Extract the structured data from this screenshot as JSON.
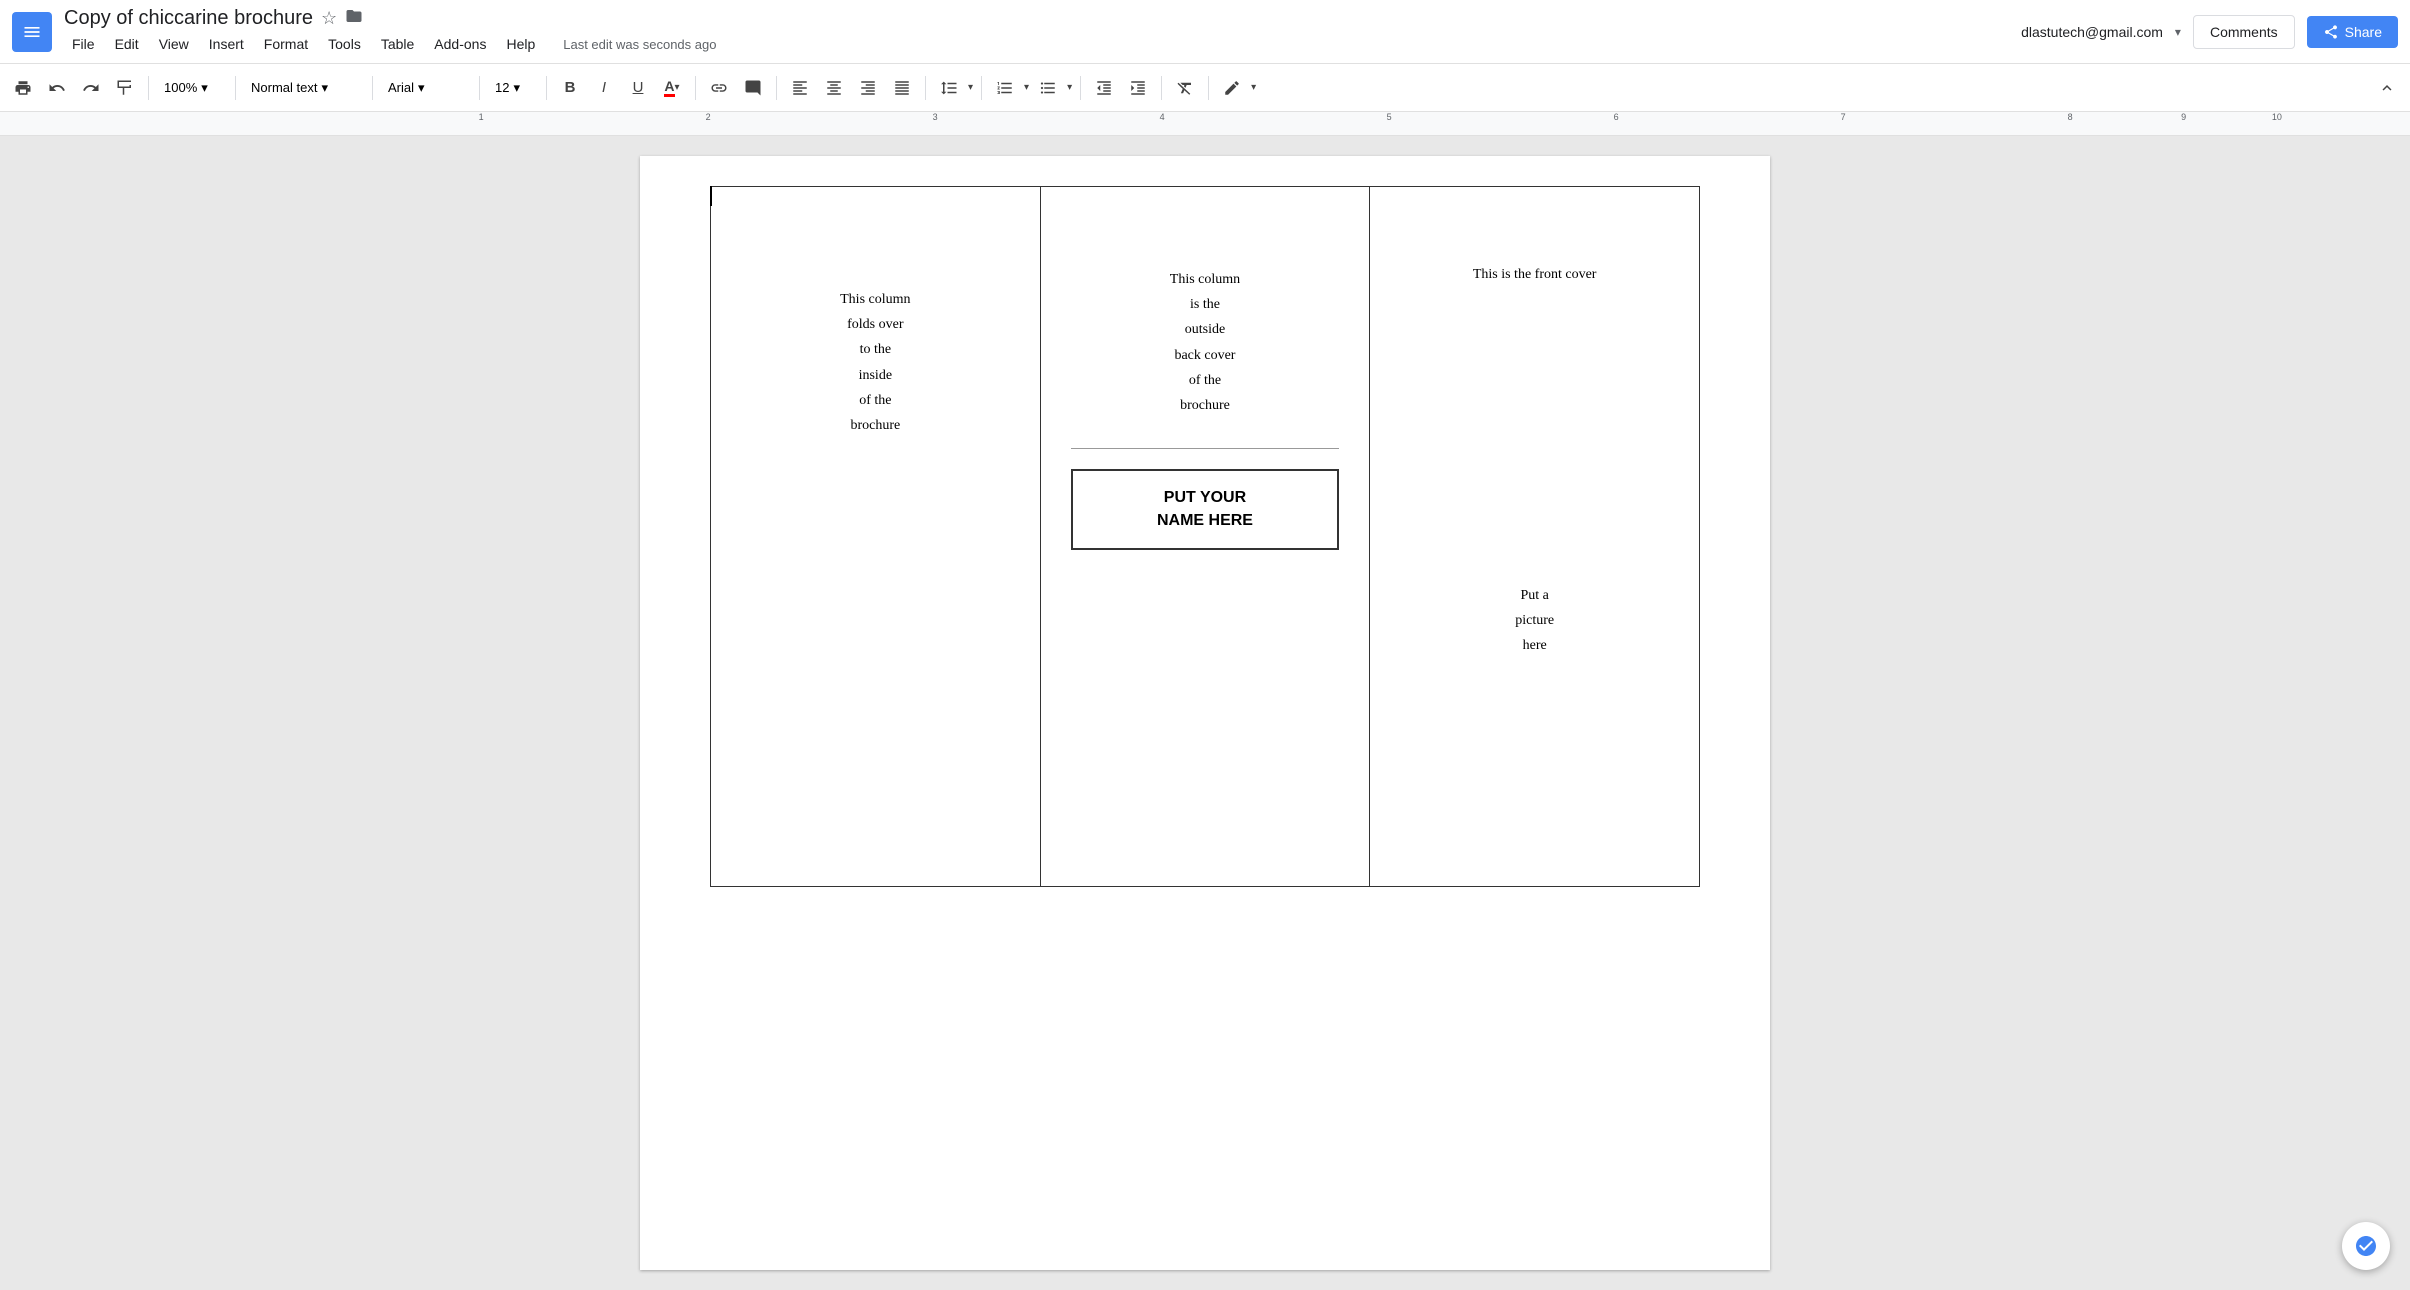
{
  "app": {
    "icon_label": "≡",
    "title": "Copy of chiccarine brochure",
    "star_icon": "☆",
    "folder_icon": "▦"
  },
  "menu": {
    "items": [
      "File",
      "Edit",
      "View",
      "Insert",
      "Format",
      "Tools",
      "Table",
      "Add-ons",
      "Help"
    ]
  },
  "status": {
    "last_edit": "Last edit was seconds ago"
  },
  "top_right": {
    "user_email": "dlastutech@gmail.com",
    "comments_label": "Comments",
    "share_label": "Share"
  },
  "toolbar": {
    "zoom": "100%",
    "style": "Normal text",
    "font": "Arial",
    "size": "12",
    "bold": "B",
    "italic": "I",
    "underline": "U"
  },
  "document": {
    "col_left": {
      "text": "This column\nfolds over\nto the\ninside\nof the\nbrochure"
    },
    "col_center": {
      "top_text": "This column\nis the\noutside\nback cover\nof the\nbrochure",
      "name_box_line1": "PUT YOUR",
      "name_box_line2": "NAME HERE"
    },
    "col_right": {
      "front_cover": "This is the front cover",
      "picture_text": "Put a\npicture\nhere"
    }
  }
}
